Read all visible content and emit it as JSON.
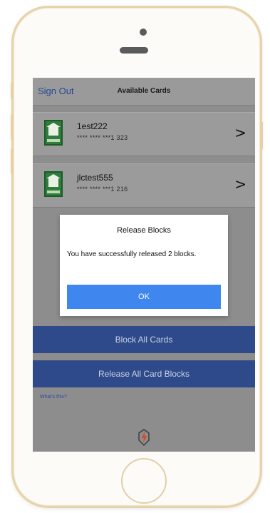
{
  "nav": {
    "sign_out_label": "Sign Out",
    "title": "Available Cards"
  },
  "cards": [
    {
      "name": "1est222",
      "number": "**** **** ***1 323"
    },
    {
      "name": "jlctest555",
      "number": "**** **** ***1 216"
    }
  ],
  "actions": {
    "block_all_label": "Block All Cards",
    "release_all_label": "Release All Card Blocks",
    "whats_this_label": "What's this?"
  },
  "dialog": {
    "title": "Release Blocks",
    "message": "You have successfully released 2 blocks.",
    "ok_label": "OK"
  },
  "colors": {
    "accent_blue": "#3f87ee",
    "action_blue": "#2f4a8a",
    "link_blue": "#27469a",
    "phone_frame": "#e7d3ab"
  }
}
